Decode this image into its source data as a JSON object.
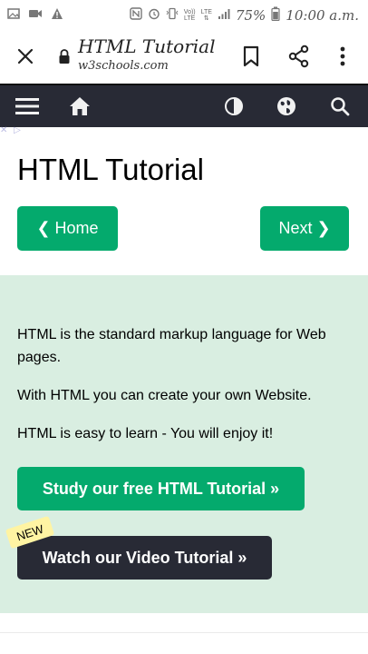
{
  "status_bar": {
    "time": "10:00 a.m.",
    "battery_percent": "75%",
    "volte_top": "Vo))",
    "volte_mid": "LTE",
    "volte_bottom": "LTE1",
    "signal_network": "LTE",
    "icons": [
      "photo-icon",
      "video-icon",
      "warning-icon",
      "nfc-icon",
      "alarm-icon",
      "vibrate-icon",
      "signal-icon",
      "battery-icon"
    ]
  },
  "browser": {
    "tab_title": "HTML Tutorial",
    "url": "w3schools.com",
    "icons": [
      "close-icon",
      "lock-icon",
      "bookmark-icon",
      "share-icon",
      "more-icon"
    ]
  },
  "site_nav": {
    "icons": [
      "menu-icon",
      "home-icon",
      "contrast-icon",
      "globe-icon",
      "search-icon"
    ]
  },
  "content": {
    "title": "HTML Tutorial",
    "home_button": "❮ Home",
    "next_button": "Next ❯",
    "paragraphs": [
      "HTML is the standard markup language for Web pages.",
      "With HTML you can create your own Website.",
      "HTML is easy to learn - You will enjoy it!"
    ],
    "study_button": "Study our free HTML Tutorial »",
    "video_button": "Watch our Video Tutorial »",
    "new_badge": "NEW"
  },
  "colors": {
    "accent_green": "#04aa6d",
    "nav_dark": "#282a35",
    "intro_bg": "#d9eee1",
    "badge_yellow": "#fff4a3"
  }
}
